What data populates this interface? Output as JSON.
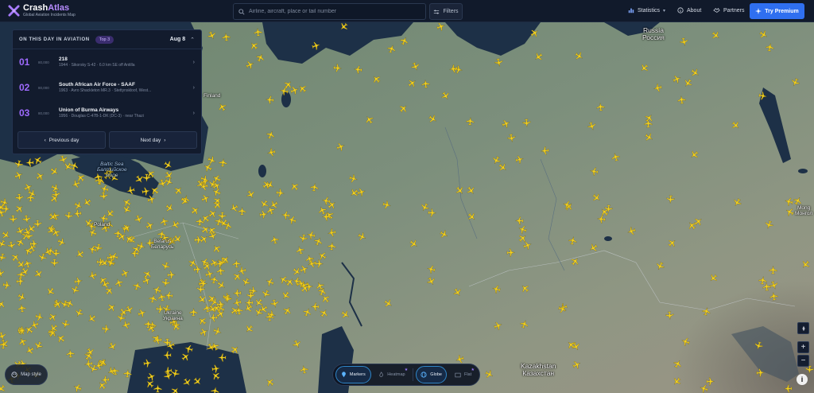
{
  "app": {
    "name_part1": "Crash",
    "name_part2": "Atlas",
    "tagline": "Global Aviation Incidents Map"
  },
  "search": {
    "placeholder": "Airline, aircraft, place or tail number"
  },
  "toolbar": {
    "filters_label": "Filters"
  },
  "nav": {
    "statistics": "Statistics",
    "about": "About",
    "partners": "Partners",
    "premium": "Try Premium"
  },
  "on_this_day": {
    "title": "ON THIS DAY IN AVIATION",
    "badge": "Top 3",
    "date": "Aug 8",
    "items": [
      {
        "rank": "01",
        "tag": "80,000",
        "title": "218",
        "subtitle": "1944 · Sikorsky S-42 · 6.0 km SE off Antilla"
      },
      {
        "rank": "02",
        "tag": "80,000",
        "title": "South African Air Force - SAAF",
        "subtitle": "1963 · Avro Shackleton MR.3 · Stettynskloof, West..."
      },
      {
        "rank": "03",
        "tag": "80,000",
        "title": "Union of Burma Airways",
        "subtitle": "1956 · Douglas C-47B-1-DK (DC-3) · near Thazi"
      }
    ],
    "prev_label": "Previous day",
    "next_label": "Next day"
  },
  "map_labels": {
    "russia": "Russia\nРоссия",
    "finland": "Finland",
    "baltic": "Baltic Sea\nБалтийское\nморе",
    "belarus": "Belarus\nБеларусь",
    "ukraine": "Ukraine\nУкраина",
    "poland": "Poland",
    "kazakhstan": "Kazakhstan\nКазахстан",
    "mongolia": "Mong\nМонгол"
  },
  "controls": {
    "map_style": "Map style",
    "markers": "Markers",
    "heatmap": "Heatmap",
    "globe": "Globe",
    "flat": "Flat",
    "zoom_in": "+",
    "zoom_out": "−",
    "info": "i"
  },
  "icons": {
    "logo": "plane-logo-icon",
    "search": "search-icon",
    "filters": "sliders-icon",
    "statistics": "bar-chart-icon",
    "about": "info-circle-icon",
    "partners": "handshake-icon",
    "premium": "sparkle-icon",
    "marker": "plane-marker-icon"
  },
  "colors": {
    "accent_purple": "#9f6bff",
    "premium_blue": "#2f6ff0",
    "marker_yellow": "#f5d21f",
    "topbar_bg": "#111a2b"
  }
}
